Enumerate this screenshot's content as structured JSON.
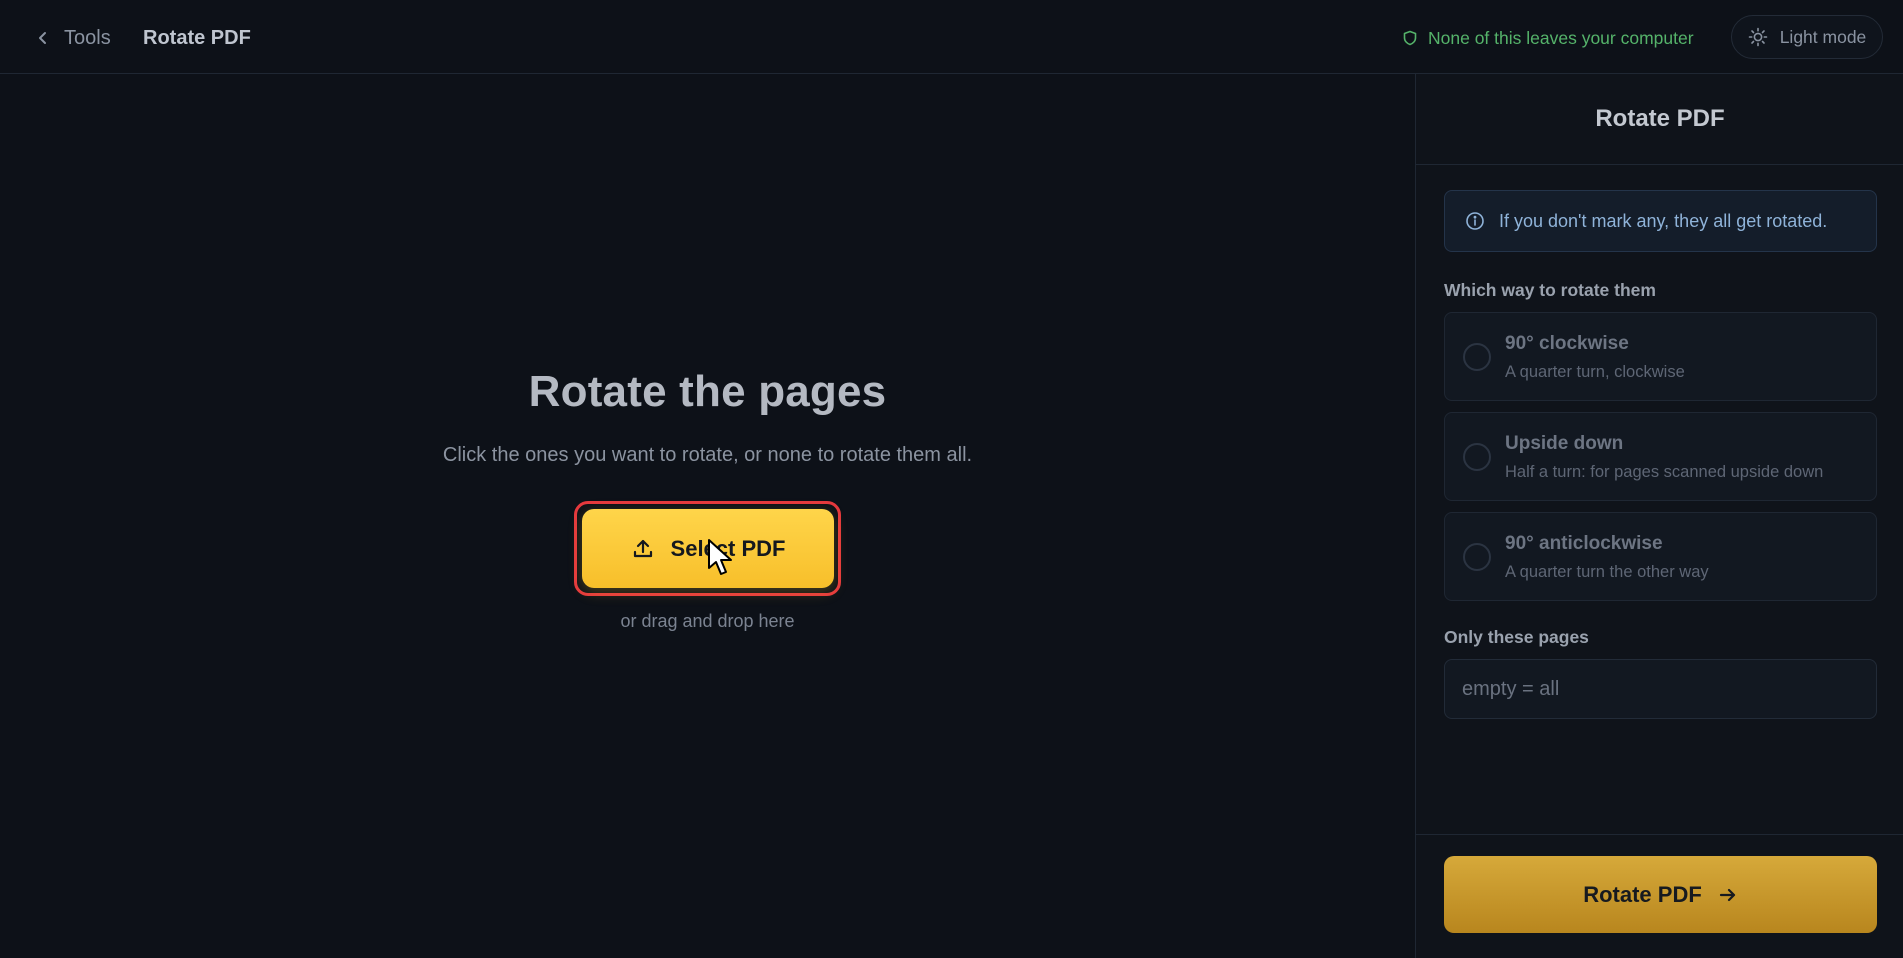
{
  "header": {
    "back_label": "Tools",
    "title": "Rotate PDF",
    "privacy_text": "None of this leaves your computer",
    "theme_toggle_label": "Light mode"
  },
  "main": {
    "heading": "Rotate the pages",
    "subheading": "Click the ones you want to rotate, or none to rotate them all.",
    "select_button_label": "Select PDF",
    "drag_hint": "or drag and drop here"
  },
  "panel": {
    "title": "Rotate PDF",
    "info_text": "If you don't mark any, they all get rotated.",
    "direction_label": "Which way to rotate them",
    "options": [
      {
        "title": "90° clockwise",
        "description": "A quarter turn, clockwise"
      },
      {
        "title": "Upside down",
        "description": "Half a turn: for pages scanned upside down"
      },
      {
        "title": "90° anticlockwise",
        "description": "A quarter turn the other way"
      }
    ],
    "pages_label": "Only these pages",
    "pages_placeholder": "empty = all",
    "pages_value": "",
    "submit_label": "Rotate PDF"
  },
  "colors": {
    "accent": "#f7bf2a",
    "privacy": "#55b36a",
    "focus_ring": "#e5393e",
    "background": "#0d1118"
  },
  "icons": {
    "back": "chevron-left-icon",
    "privacy": "shield-icon",
    "theme": "sun-icon",
    "upload": "upload-icon",
    "info": "info-icon",
    "submit": "arrow-right-icon"
  }
}
